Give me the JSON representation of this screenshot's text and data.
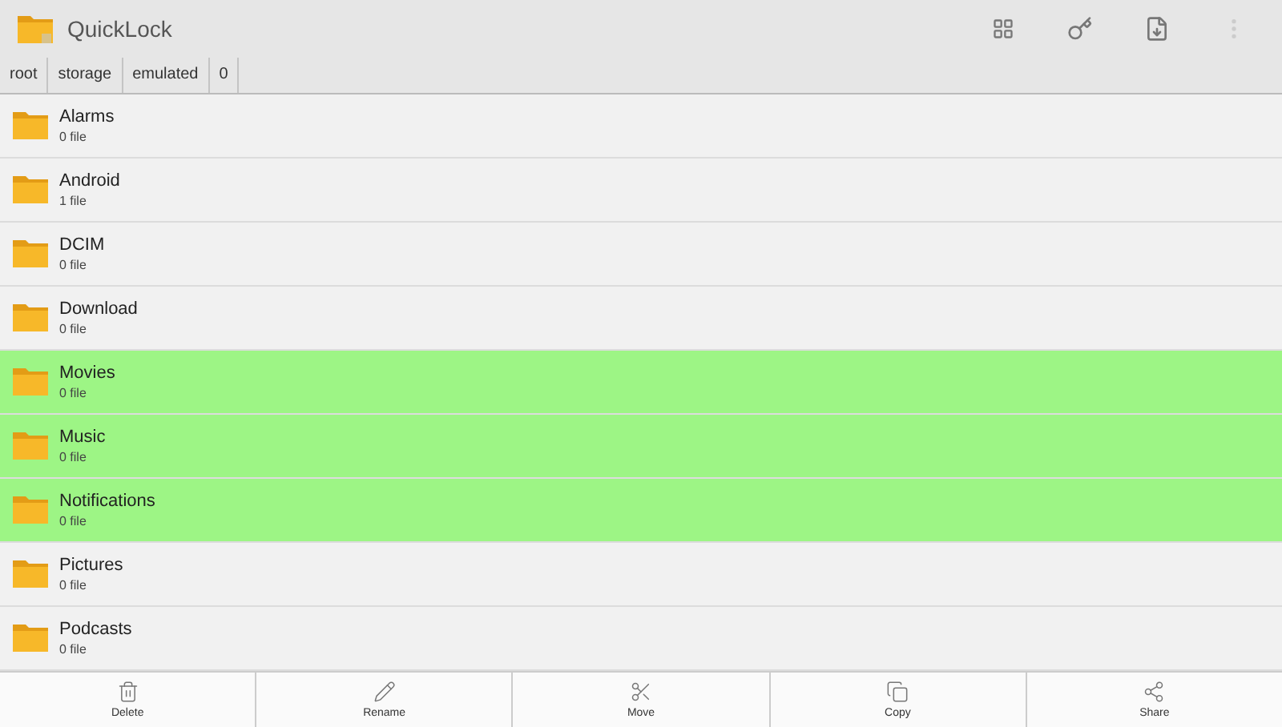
{
  "app": {
    "title": "QuickLock"
  },
  "breadcrumbs": [
    "root",
    "storage",
    "emulated",
    "0"
  ],
  "folders": [
    {
      "name": "Alarms",
      "count": "0 file",
      "selected": false
    },
    {
      "name": "Android",
      "count": "1 file",
      "selected": false
    },
    {
      "name": "DCIM",
      "count": "0 file",
      "selected": false
    },
    {
      "name": "Download",
      "count": "0 file",
      "selected": false
    },
    {
      "name": "Movies",
      "count": "0 file",
      "selected": true
    },
    {
      "name": "Music",
      "count": "0 file",
      "selected": true
    },
    {
      "name": "Notifications",
      "count": "0 file",
      "selected": true
    },
    {
      "name": "Pictures",
      "count": "0 file",
      "selected": false
    },
    {
      "name": "Podcasts",
      "count": "0 file",
      "selected": false
    }
  ],
  "actions": [
    {
      "kind": "delete",
      "label": "Delete"
    },
    {
      "kind": "rename",
      "label": "Rename"
    },
    {
      "kind": "move",
      "label": "Move"
    },
    {
      "kind": "copy",
      "label": "Copy"
    },
    {
      "kind": "share",
      "label": "Share"
    }
  ]
}
